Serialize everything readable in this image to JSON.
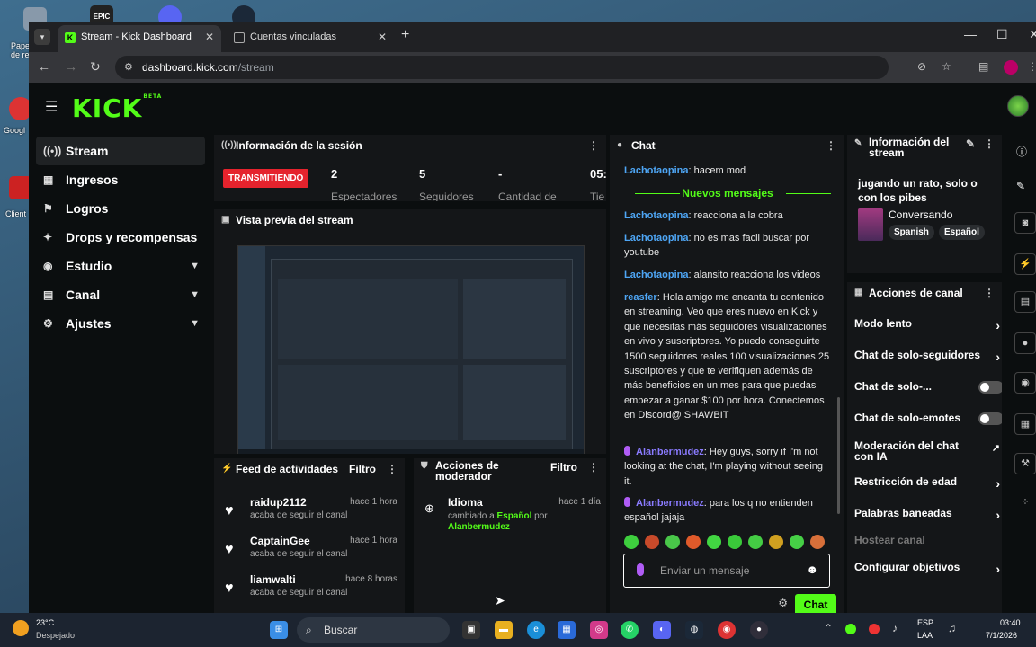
{
  "browser": {
    "tabs": [
      {
        "label": "Stream - Kick Dashboard",
        "active": true
      },
      {
        "label": "Cuentas vinculadas",
        "active": false
      }
    ],
    "url_host": "dashboard.kick.com",
    "url_path": "/stream"
  },
  "desktop": {
    "icons": [
      {
        "label": "Papel de re",
        "color": "#8899aa"
      },
      {
        "label": "EPIC",
        "color": "#222222"
      },
      {
        "label": "Googl",
        "color": "#d33"
      },
      {
        "label": "Client",
        "color": "#c22"
      }
    ]
  },
  "kick": {
    "logo": "KICK",
    "logo_beta": "BETA",
    "brand_color": "#53fc18",
    "sidebar": [
      {
        "label": "Stream",
        "icon": "stream-icon",
        "glyph": "((•))",
        "active": true,
        "expand": false
      },
      {
        "label": "Ingresos",
        "icon": "revenue-icon",
        "glyph": "▦",
        "active": false,
        "expand": false
      },
      {
        "label": "Logros",
        "icon": "achievements-icon",
        "glyph": "⚑",
        "active": false,
        "expand": false
      },
      {
        "label": "Drops y recompensas",
        "icon": "drops-icon",
        "glyph": "✦",
        "active": false,
        "expand": false
      },
      {
        "label": "Estudio",
        "icon": "studio-icon",
        "glyph": "◉",
        "active": false,
        "expand": true
      },
      {
        "label": "Canal",
        "icon": "channel-icon",
        "glyph": "▤",
        "active": false,
        "expand": true
      },
      {
        "label": "Ajustes",
        "icon": "settings-icon",
        "glyph": "⚙",
        "active": false,
        "expand": true
      }
    ],
    "session": {
      "title": "Información de la sesión",
      "live_badge": "TRANSMITIENDO",
      "stats": [
        {
          "value": "2",
          "label": "Espectadores"
        },
        {
          "value": "5",
          "label": "Seguidores"
        },
        {
          "value": "-",
          "label": "Cantidad de"
        },
        {
          "value": "05:",
          "label": "Tie"
        }
      ]
    },
    "preview": {
      "title": "Vista previa del stream"
    },
    "activity": {
      "title": "Feed de actividades",
      "filter": "Filtro",
      "items": [
        {
          "name": "raidup2112",
          "desc": "acaba de seguir el canal",
          "time": "hace 1 hora"
        },
        {
          "name": "CaptainGee",
          "desc": "acaba de seguir el canal",
          "time": "hace 1 hora"
        },
        {
          "name": "liamwalti",
          "desc": "acaba de seguir el canal",
          "time": "hace 8 horas"
        }
      ]
    },
    "mod_actions": {
      "title": "Acciones de moderador",
      "filter": "Filtro",
      "item": {
        "name": "Idioma",
        "time": "hace 1 día",
        "desc_prefix": "cambiado a",
        "value": "Español",
        "desc_by": "por",
        "user": "Alanbermudez"
      }
    },
    "chat": {
      "title": "Chat",
      "new_messages": "Nuevos mensajes",
      "messages": [
        {
          "user": "Lachotaopina",
          "color": "#4ea6f5",
          "text": "hacem mod"
        },
        {
          "user": "Lachotaopina",
          "color": "#4ea6f5",
          "text": "reacciona a la cobra"
        },
        {
          "user": "Lachotaopina",
          "color": "#4ea6f5",
          "text": "no es mas facil buscar por youtube"
        },
        {
          "user": "Lachotaopina",
          "color": "#4ea6f5",
          "text": "alansito reacciona los videos"
        },
        {
          "user": "reasfer",
          "color": "#4ea6f5",
          "text": "Hola amigo me encanta tu contenido en streaming. Veo que eres nuevo en Kick y que necesitas más seguidores visualizaciones en vivo y suscriptores. Yo puedo conseguirte 1500 seguidores reales 100 visualizaciones 25 suscriptores y que te verifiquen además de más beneficios en un mes para que puedas empezar a ganar $100 por hora. Conectemos en Discord@ SHAWBIT"
        },
        {
          "user": "Alanbermudez",
          "color": "#8a7bff",
          "text": "Hey guys, sorry if I'm not looking at the chat, I'm playing without seeing it."
        },
        {
          "user": "Alanbermudez",
          "color": "#8a7bff",
          "text": "para los q no entienden español jajaja"
        }
      ],
      "input_placeholder": "Enviar un mensaje",
      "send_label": "Chat"
    },
    "stream_info": {
      "title": "Información del stream",
      "stream_title": "jugando un rato, solo o con los pibes",
      "category": "Conversando",
      "tags": [
        "Spanish",
        "Español"
      ]
    },
    "channel_actions": {
      "title": "Acciones de canal",
      "items": [
        {
          "label": "Modo lento",
          "kind": "chevron"
        },
        {
          "label": "Chat de solo-seguidores",
          "kind": "chevron"
        },
        {
          "label": "Chat de solo-...",
          "kind": "toggle"
        },
        {
          "label": "Chat de solo-emotes",
          "kind": "toggle"
        },
        {
          "label": "Moderación del chat con IA",
          "kind": "external"
        },
        {
          "label": "Restricción de edad",
          "kind": "chevron"
        },
        {
          "label": "Palabras baneadas",
          "kind": "chevron"
        },
        {
          "label": "Hostear canal",
          "kind": "disabled"
        },
        {
          "label": "Configurar objetivos",
          "kind": "chevron"
        }
      ]
    }
  },
  "taskbar": {
    "weather_temp": "23°C",
    "weather_desc": "Despejado",
    "search_placeholder": "Buscar",
    "lang": "ESP",
    "region": "LAA",
    "time": "03:40",
    "date": "7/1/2026"
  }
}
